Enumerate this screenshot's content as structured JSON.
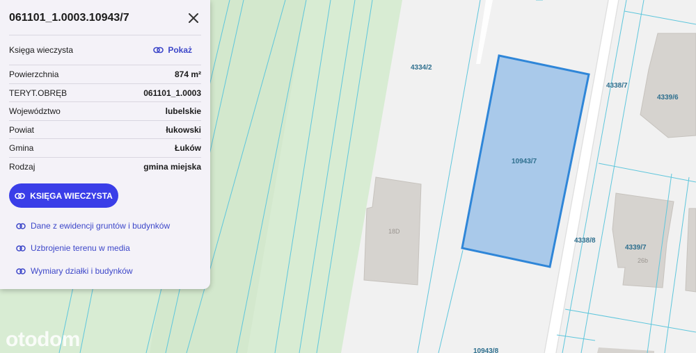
{
  "panel": {
    "title": "061101_1.0003.10943/7",
    "kw_label": "Księga wieczysta",
    "kw_link": "Pokaż",
    "rows": [
      {
        "label": "Powierzchnia",
        "value": "874 m²"
      },
      {
        "label": "TERYT.OBRĘB",
        "value": "061101_1.0003"
      },
      {
        "label": "Województwo",
        "value": "lubelskie"
      },
      {
        "label": "Powiat",
        "value": "łukowski"
      },
      {
        "label": "Gmina",
        "value": "Łuków"
      },
      {
        "label": "Rodzaj",
        "value": "gmina miejska"
      }
    ],
    "primary_button": "KSIĘGA WIECZYSTA",
    "links": [
      "Dane z ewidencji gruntów i budynków",
      "Uzbrojenie terenu w media",
      "Wymiary działki i budynków"
    ],
    "icons": {
      "close": "close-icon",
      "link": "link-icon"
    }
  },
  "map": {
    "parcel_labels": [
      "4334/2",
      "4338/7",
      "4339/6",
      "10943/7",
      "4338/8",
      "4339/7",
      "10943/8"
    ],
    "building_labels": [
      "18D",
      "26b"
    ],
    "selected_parcel": "10943/7",
    "colors": {
      "selected_fill": "#a9c9ea",
      "selected_border": "#2f86d8",
      "parcel_line": "#5ec6dc",
      "green_area": "#d8ecd3"
    }
  },
  "watermark": "otodom"
}
